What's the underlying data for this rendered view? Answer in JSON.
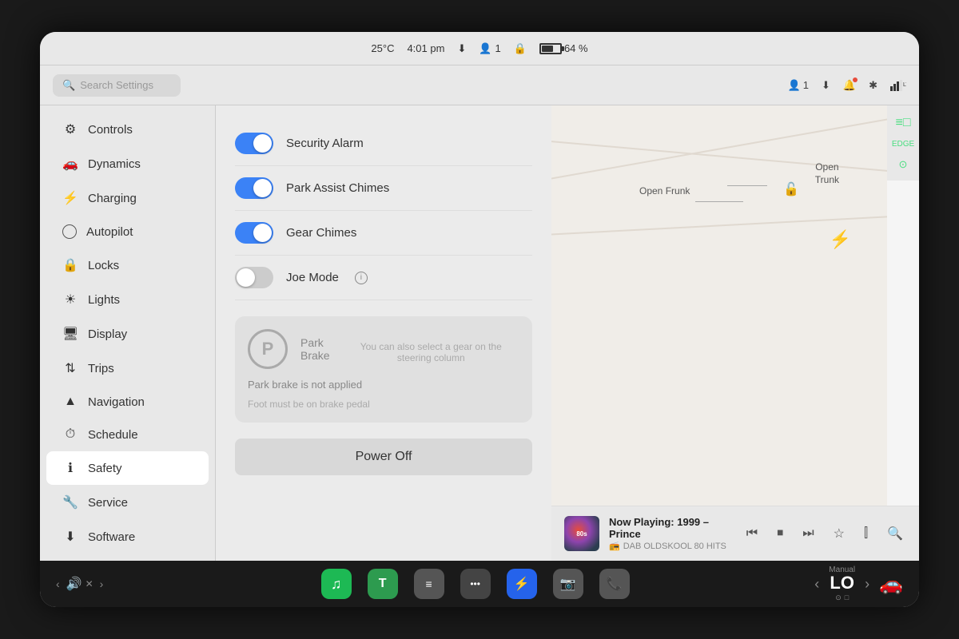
{
  "screen": {
    "status_bar": {
      "temperature": "25°C",
      "time": "4:01 pm",
      "passengers": "1",
      "battery_percent": "64 %"
    },
    "nav_bar": {
      "search_placeholder": "Search Settings",
      "passengers": "1",
      "signal_bars": "LTE"
    },
    "sidebar": {
      "items": [
        {
          "id": "controls",
          "label": "Controls",
          "icon": "⚙"
        },
        {
          "id": "dynamics",
          "label": "Dynamics",
          "icon": "🚗"
        },
        {
          "id": "charging",
          "label": "Charging",
          "icon": "⚡"
        },
        {
          "id": "autopilot",
          "label": "Autopilot",
          "icon": "◎"
        },
        {
          "id": "locks",
          "label": "Locks",
          "icon": "🔒"
        },
        {
          "id": "lights",
          "label": "Lights",
          "icon": "☀"
        },
        {
          "id": "display",
          "label": "Display",
          "icon": "🖥"
        },
        {
          "id": "trips",
          "label": "Trips",
          "icon": "↕"
        },
        {
          "id": "navigation",
          "label": "Navigation",
          "icon": "▲"
        },
        {
          "id": "schedule",
          "label": "Schedule",
          "icon": "⏰"
        },
        {
          "id": "safety",
          "label": "Safety",
          "icon": "ℹ"
        },
        {
          "id": "service",
          "label": "Service",
          "icon": "🔧"
        },
        {
          "id": "software",
          "label": "Software",
          "icon": "⬇"
        }
      ]
    },
    "settings": {
      "toggles": [
        {
          "id": "security-alarm",
          "label": "Security Alarm",
          "state": true
        },
        {
          "id": "park-assist-chimes",
          "label": "Park Assist Chimes",
          "state": true
        },
        {
          "id": "gear-chimes",
          "label": "Gear Chimes",
          "state": true
        },
        {
          "id": "joe-mode",
          "label": "Joe Mode",
          "state": false,
          "has_info": true
        }
      ],
      "park_brake": {
        "title": "Park\nBrake",
        "status": "Park brake is not applied",
        "gear_hint": "You can also select a gear on the steering column",
        "foot_note": "Foot must be on brake pedal"
      },
      "power_off_label": "Power Off"
    },
    "car_panel": {
      "open_frunk": "Open\nFrunk",
      "open_trunk": "Open\nTrunk"
    },
    "music_player": {
      "now_playing": "Now Playing: 1999 – Prince",
      "station": "DAB OLDSKOOL 80 HITS"
    },
    "taskbar": {
      "apps": [
        {
          "id": "spotify",
          "label": "Spotify",
          "color": "#1DB954",
          "symbol": "♫"
        },
        {
          "id": "app2",
          "label": "App2",
          "color": "#4ade80",
          "symbol": "T"
        },
        {
          "id": "app3",
          "label": "App3",
          "color": "#555",
          "symbol": "≡"
        },
        {
          "id": "app4",
          "label": "More",
          "color": "#555",
          "symbol": "•••"
        },
        {
          "id": "bluetooth",
          "label": "Bluetooth",
          "color": "#3b82f6",
          "symbol": "⚡"
        },
        {
          "id": "camera",
          "label": "Camera",
          "color": "#555",
          "symbol": "📷"
        },
        {
          "id": "phone",
          "label": "Phone",
          "color": "#555",
          "symbol": "📞"
        }
      ],
      "volume_label": "🔊",
      "gear": "LO",
      "gear_mode": "Manual",
      "car_icon": "🚗"
    },
    "right_panel": {
      "icons": [
        "≡□",
        "EDGE",
        "⊙"
      ]
    }
  }
}
